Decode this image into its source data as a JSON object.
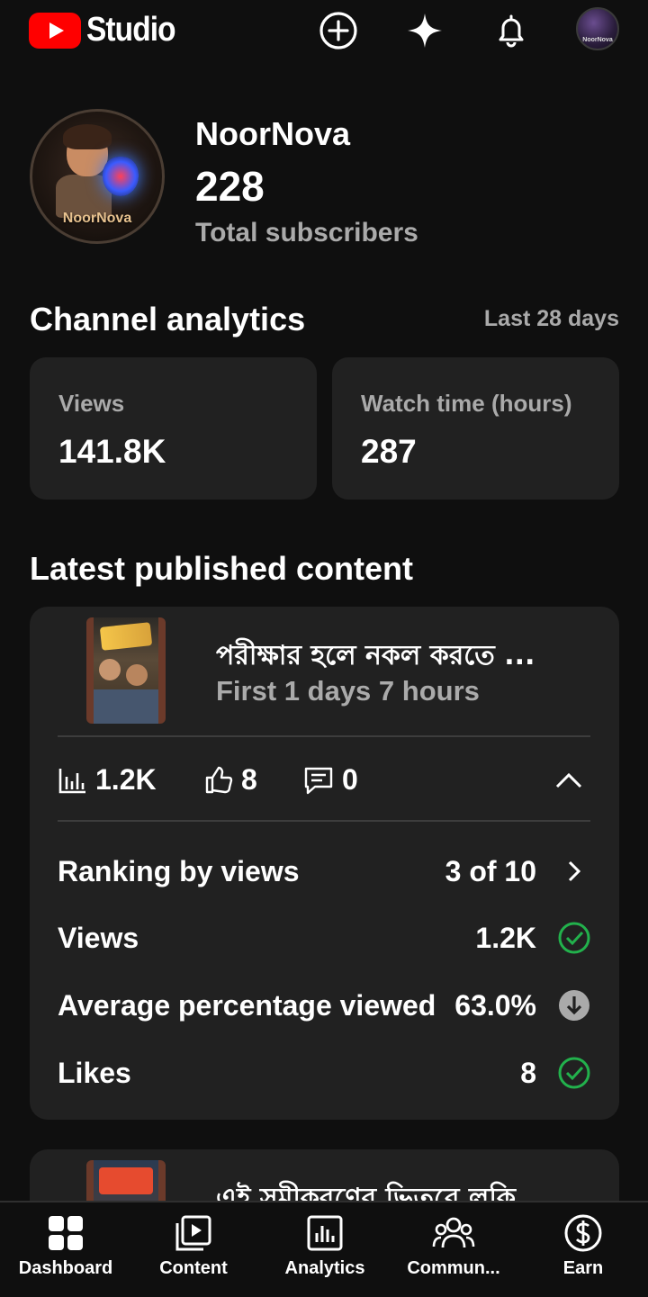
{
  "app": {
    "logo_text": "Studio",
    "brand_color": "#ff0000",
    "accent_green": "#22b14c",
    "background": "#0f0f0f",
    "card_background": "#212121"
  },
  "topbar": {
    "icons": [
      "create-icon",
      "sparkle-icon",
      "notifications-icon",
      "account-avatar"
    ],
    "avatar_text": "NoorNova"
  },
  "channel": {
    "name": "NoorNova",
    "avatar_label": "NoorNova",
    "subscribers": "228",
    "subscribers_label": "Total subscribers"
  },
  "analytics": {
    "title": "Channel analytics",
    "period": "Last 28 days",
    "cards": [
      {
        "label": "Views",
        "value": "141.8K"
      },
      {
        "label": "Watch time (hours)",
        "value": "287"
      }
    ]
  },
  "latest": {
    "title": "Latest published content",
    "video": {
      "title": "পরীক্ষার হলে নকল করতে ...",
      "subtitle": "First 1 days 7 hours",
      "views": "1.2K",
      "likes": "8",
      "comments": "0",
      "rows": [
        {
          "label": "Ranking by views",
          "value": "3 of 10",
          "icon": "chevron-right-icon"
        },
        {
          "label": "Views",
          "value": "1.2K",
          "icon": "check-circle-icon"
        },
        {
          "label": "Average percentage viewed",
          "value": "63.0%",
          "icon": "arrow-down-circle-icon"
        },
        {
          "label": "Likes",
          "value": "8",
          "icon": "check-circle-icon"
        }
      ]
    },
    "video2": {
      "title": "এই সমীকরণের ভিতরে লুকি..."
    }
  },
  "nav": [
    {
      "label": "Dashboard",
      "icon": "dashboard-icon"
    },
    {
      "label": "Content",
      "icon": "content-icon"
    },
    {
      "label": "Analytics",
      "icon": "analytics-icon"
    },
    {
      "label": "Commun...",
      "icon": "community-icon"
    },
    {
      "label": "Earn",
      "icon": "earn-icon"
    }
  ]
}
